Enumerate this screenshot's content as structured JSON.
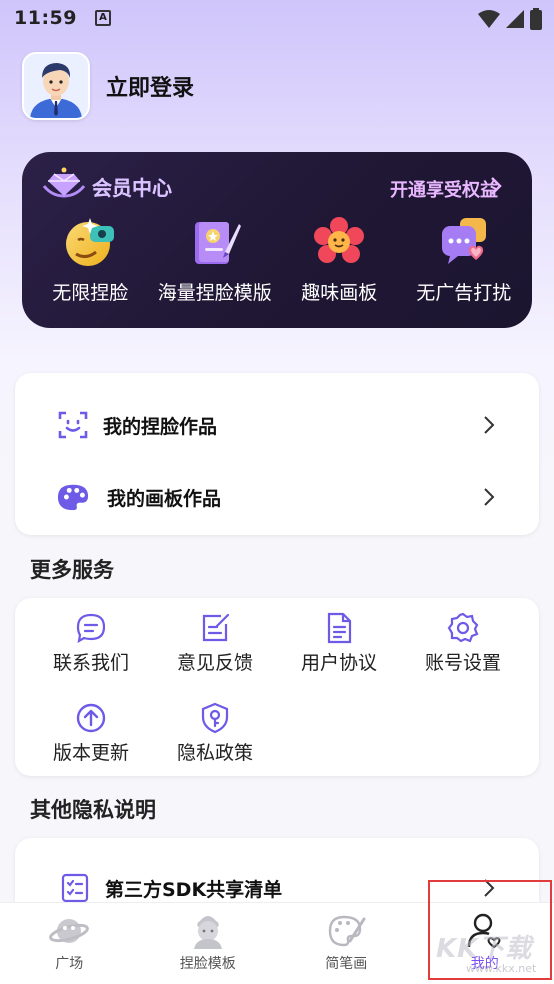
{
  "status_bar": {
    "time": "11:59",
    "a_icon": "A"
  },
  "profile": {
    "login_label": "立即登录"
  },
  "vip": {
    "title": "会员中心",
    "link": "开通享受权益",
    "benefits": [
      {
        "label": "无限捏脸",
        "icon": "emoji-face-icon"
      },
      {
        "label": "海量捏脸模版",
        "icon": "template-book-icon"
      },
      {
        "label": "趣味画板",
        "icon": "flower-icon"
      },
      {
        "label": "无广告打扰",
        "icon": "chat-bubbles-icon"
      }
    ]
  },
  "works": [
    {
      "label": "我的捏脸作品",
      "icon": "face-scan-icon"
    },
    {
      "label": "我的画板作品",
      "icon": "palette-icon"
    }
  ],
  "more_services": {
    "title": "更多服务",
    "items": [
      {
        "label": "联系我们",
        "icon": "message-icon"
      },
      {
        "label": "意见反馈",
        "icon": "feedback-icon"
      },
      {
        "label": "用户协议",
        "icon": "document-icon"
      },
      {
        "label": "账号设置",
        "icon": "settings-icon"
      },
      {
        "label": "版本更新",
        "icon": "update-icon"
      },
      {
        "label": "隐私政策",
        "icon": "privacy-icon"
      }
    ]
  },
  "other_privacy": {
    "title": "其他隐私说明",
    "items": [
      {
        "label": "第三方SDK共享清单",
        "icon": "checklist-icon"
      }
    ]
  },
  "tabbar": {
    "tabs": [
      {
        "label": "广场",
        "icon": "planet-icon"
      },
      {
        "label": "捏脸模板",
        "icon": "face-template-icon"
      },
      {
        "label": "简笔画",
        "icon": "brush-palette-icon"
      },
      {
        "label": "我的",
        "icon": "user-heart-icon",
        "active": true
      }
    ]
  },
  "watermark": {
    "text": "KK下载",
    "sub": "www.kkx.net"
  },
  "colors": {
    "accent": "#7b4ff0",
    "vip_bg": "#1f1734",
    "vip_link": "#e9b7ff"
  }
}
